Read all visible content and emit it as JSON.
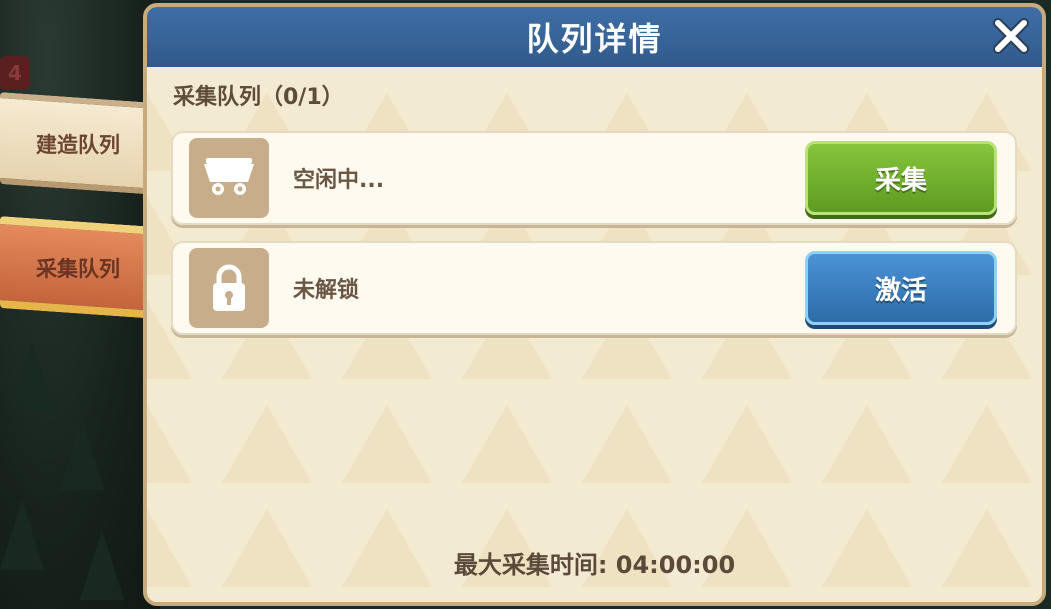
{
  "background": {
    "badge_count": "4"
  },
  "sidebar": {
    "tabs": [
      {
        "label": "建造队列",
        "active": false
      },
      {
        "label": "采集队列",
        "active": true
      }
    ]
  },
  "dialog": {
    "title": "队列详情",
    "close_icon": "close-x-icon",
    "section_label": "采集队列（0/1）",
    "rows": [
      {
        "icon": "mine-cart-icon",
        "status": "空闲中...",
        "button_label": "采集",
        "button_color": "#6aaf2c"
      },
      {
        "icon": "padlock-icon",
        "status": "未解锁",
        "button_label": "激活",
        "button_color": "#3a82c4"
      }
    ],
    "footer": "最大采集时间: 04:00:00"
  },
  "colors": {
    "titlebar": "#3a679e",
    "panel": "#f3ead2",
    "border": "#c7ab7f"
  }
}
